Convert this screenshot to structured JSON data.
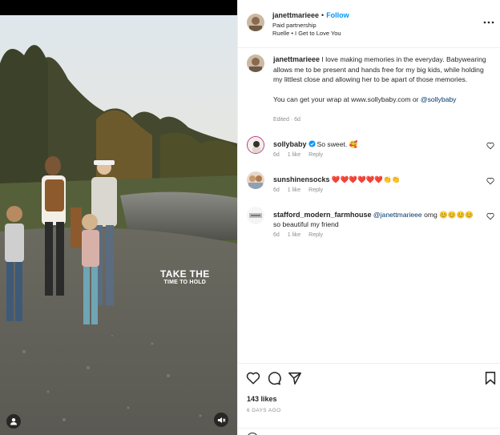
{
  "post": {
    "author": "janettmarieee",
    "dot": "•",
    "follow_label": "Follow",
    "paid_partnership": "Paid partnership",
    "audio": "Ruelle • I Get to Love You"
  },
  "media": {
    "overlay_line1": "TAKE THE",
    "overlay_line2": "TIME TO HOLD"
  },
  "caption": {
    "author": "janettmarieee",
    "text": " I love making memories in the everyday. Babywearing allows me to be present and hands free for my big kids, while holding my littlest close and allowing her to be apart of those memories.",
    "text2_prefix": "You can get your wrap at www.sollybaby.com or ",
    "text2_mention": "@sollybaby",
    "meta": "Edited · 6d"
  },
  "comments": [
    {
      "user": "sollybaby",
      "text": "So sweet. 🥰",
      "age": "6d",
      "likes": "1 like",
      "reply": "Reply"
    },
    {
      "user": "sunshinensocks",
      "text": "❤️❤️❤️❤️❤️❤️👏👏",
      "age": "6d",
      "likes": "1 like",
      "reply": "Reply"
    },
    {
      "user": "stafford_modern_farmhouse",
      "mention": "@janettmarieee",
      "text": " omg 😊😊😊😊 so beautiful my friend",
      "age": "6d",
      "likes": "1 like",
      "reply": "Reply"
    }
  ],
  "actions": {
    "likes": "143 likes",
    "ago": "6 DAYS AGO"
  },
  "icons": [
    "heart-icon",
    "comment-icon",
    "share-icon",
    "bookmark-icon",
    "more-icon",
    "verified-icon",
    "mute-icon",
    "user-tag-icon"
  ],
  "colors": {
    "accent": "#0095f6",
    "link": "#00376b",
    "muted": "#8e8e8e"
  }
}
